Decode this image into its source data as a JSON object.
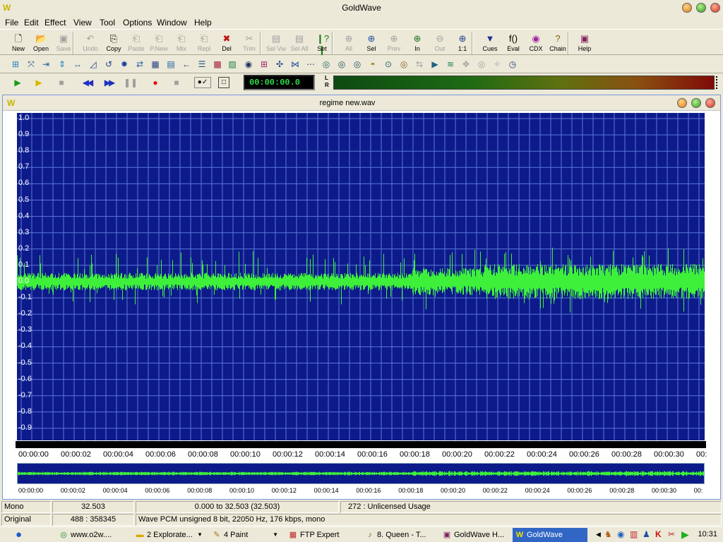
{
  "window": {
    "title": "GoldWave",
    "app_icon": "goldwave-logo-icon"
  },
  "menu": [
    "File",
    "Edit",
    "Effect",
    "View",
    "Tool",
    "Options",
    "Window",
    "Help"
  ],
  "toolbar": [
    {
      "label": "New",
      "icon": "new-file-icon",
      "enabled": true
    },
    {
      "label": "Open",
      "icon": "open-folder-icon",
      "enabled": true
    },
    {
      "label": "Save",
      "icon": "save-disk-icon",
      "enabled": false
    },
    {
      "label": "Undo",
      "icon": "undo-icon",
      "enabled": false
    },
    {
      "label": "Copy",
      "icon": "copy-icon",
      "enabled": true
    },
    {
      "label": "Paste",
      "icon": "paste-icon",
      "enabled": false
    },
    {
      "label": "P.New",
      "icon": "paste-new-icon",
      "enabled": false
    },
    {
      "label": "Mix",
      "icon": "mix-icon",
      "enabled": false
    },
    {
      "label": "Repl",
      "icon": "replace-icon",
      "enabled": false
    },
    {
      "label": "Del",
      "icon": "delete-icon",
      "enabled": true
    },
    {
      "label": "Trim",
      "icon": "trim-icon",
      "enabled": false
    },
    {
      "label": "Sel Vw",
      "icon": "select-view-icon",
      "enabled": false
    },
    {
      "label": "Sel All",
      "icon": "select-all-icon",
      "enabled": false
    },
    {
      "label": "Set",
      "icon": "set-marker-icon",
      "enabled": true
    },
    {
      "label": "All",
      "icon": "zoom-all-icon",
      "enabled": false
    },
    {
      "label": "Sel",
      "icon": "zoom-selection-icon",
      "enabled": true
    },
    {
      "label": "Prev",
      "icon": "zoom-previous-icon",
      "enabled": false
    },
    {
      "label": "In",
      "icon": "zoom-in-icon",
      "enabled": true
    },
    {
      "label": "Out",
      "icon": "zoom-out-icon",
      "enabled": false
    },
    {
      "label": "1:1",
      "icon": "zoom-one-to-one-icon",
      "enabled": true
    },
    {
      "label": "Cues",
      "icon": "cues-icon",
      "enabled": true
    },
    {
      "label": "Eval",
      "icon": "evaluator-icon",
      "enabled": true
    },
    {
      "label": "CDX",
      "icon": "cd-extract-icon",
      "enabled": true
    },
    {
      "label": "Chain",
      "icon": "effect-chain-icon",
      "enabled": true
    },
    {
      "label": "Help",
      "icon": "help-book-icon",
      "enabled": true
    }
  ],
  "transport": {
    "counter": "00:00:00.0",
    "meter_left": "L",
    "meter_right": "R"
  },
  "document": {
    "title": "regime new.wav"
  },
  "waveform": {
    "y_ticks": [
      "1.0",
      "0.9",
      "0.8",
      "0.7",
      "0.6",
      "0.5",
      "0.4",
      "0.3",
      "0.2",
      "0.1",
      "0.0",
      "-0.1",
      "-0.2",
      "-0.3",
      "-0.4",
      "-0.5",
      "-0.6",
      "-0.7",
      "-0.8",
      "-0.9"
    ],
    "time_ticks": [
      "00:00:00",
      "00:00:02",
      "00:00:04",
      "00:00:06",
      "00:00:08",
      "00:00:10",
      "00:00:12",
      "00:00:14",
      "00:00:16",
      "00:00:18",
      "00:00:20",
      "00:00:22",
      "00:00:24",
      "00:00:26",
      "00:00:28",
      "00:00:30",
      "00:"
    ],
    "overview_ticks": [
      "00:00:00",
      "00:00:02",
      "00:00:04",
      "00:00:06",
      "00:00:08",
      "00:00:10",
      "00:00:12",
      "00:00:14",
      "00:00:16",
      "00:00:18",
      "00:00:20",
      "00:00:22",
      "00:00:24",
      "00:00:26",
      "00:00:28",
      "00:00:30",
      "00:"
    ],
    "colors": {
      "background": "#0d1a8a",
      "grid": "#5a78d8",
      "wave": "#3ef03a"
    }
  },
  "status": {
    "channels": "Mono",
    "length": "32.503",
    "selection": "0.000 to 32.503 (32.503)",
    "license": "272 : Unlicensed Usage",
    "view": "Original",
    "ratio": "488 : 358345",
    "format": "Wave PCM unsigned 8 bit, 22050 Hz, 176 kbps, mono"
  },
  "taskbar": {
    "items": [
      {
        "label": "www.o2w....",
        "icon": "browser-icon"
      },
      {
        "label": "2 Explorate...",
        "icon": "folder-icon"
      },
      {
        "label": "4 Paint",
        "icon": "paint-icon"
      },
      {
        "label": "FTP Expert",
        "icon": "ftp-icon"
      },
      {
        "label": "8. Queen - T...",
        "icon": "media-player-icon"
      },
      {
        "label": "GoldWave H...",
        "icon": "help-book-icon"
      },
      {
        "label": "GoldWave",
        "icon": "goldwave-logo-icon"
      }
    ],
    "clock": "10:31"
  }
}
